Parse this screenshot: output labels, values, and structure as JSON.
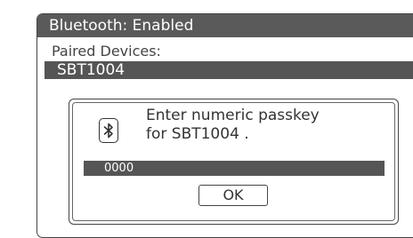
{
  "window": {
    "title": "Bluetooth: Enabled"
  },
  "paired_devices": {
    "label": "Paired Devices:",
    "items": [
      "SBT1004"
    ]
  },
  "dialog": {
    "icon": "bluetooth-icon",
    "message_line1": "Enter numeric passkey",
    "message_line2": "for SBT1004 .",
    "passkey_value": "0000",
    "ok_label": "OK"
  },
  "colors": {
    "bar": "#5a5a5a",
    "border": "#444444",
    "text": "#333333"
  }
}
